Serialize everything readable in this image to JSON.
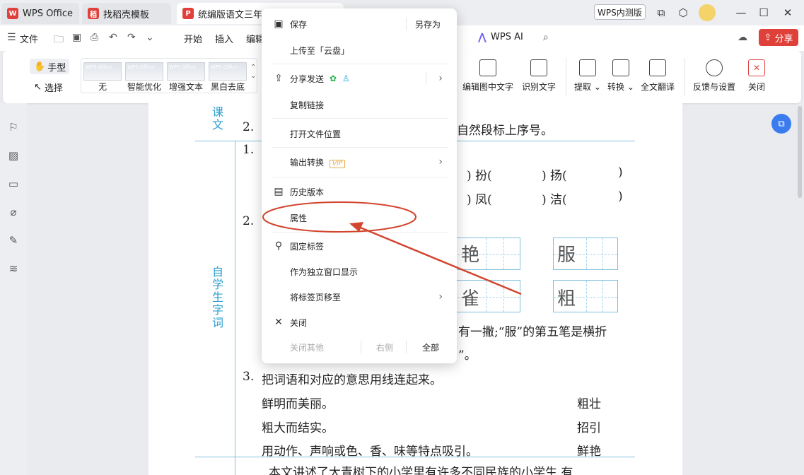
{
  "tabs": [
    {
      "label": "WPS Office",
      "color": "#e0403a"
    },
    {
      "label": "找稻壳模板",
      "color": "#e0403a"
    },
    {
      "label": "统编版语文三年级",
      "color": "#e0403a"
    }
  ],
  "titlebar": {
    "badge": "WPS内测版"
  },
  "menubar": {
    "file": "文件",
    "items": [
      "开始",
      "插入",
      "编辑"
    ],
    "wps_ai": "WPS AI",
    "share": "分享"
  },
  "ribbon": {
    "hand": "手型",
    "select": "选择",
    "thumb_brand": "WPS Office",
    "filters": [
      "无",
      "智能优化",
      "增强文本",
      "黑白去底"
    ],
    "tools": [
      "编辑图中文字",
      "识别文字",
      "提取",
      "转换",
      "全文翻译",
      "反馈与设置",
      "关闭"
    ]
  },
  "context_menu": {
    "save": "保存",
    "save_as": "另存为",
    "upload": "上传至「云盘」",
    "share_send": "分享发送",
    "copy_link": "复制链接",
    "open_location": "打开文件位置",
    "export_convert": "输出转换",
    "vip": "VIP",
    "history": "历史版本",
    "properties": "属性",
    "pin_tab": "固定标签",
    "standalone": "作为独立窗口显示",
    "move_tab": "将标签页移至",
    "close": "关闭",
    "close_others": "关闭其他",
    "right_side": "右侧",
    "all": "全部"
  },
  "document": {
    "label_kewen": "课文",
    "label_zixue": "自学生字词",
    "q2_top": "2.",
    "q2_top_text": "自然段标上序号。",
    "q1": "1.",
    "row1": [
      ") 扮(",
      ") 扬(",
      ")"
    ],
    "row2": [
      ") 凤(",
      ") 洁(",
      ")"
    ],
    "q2_mid": "2.",
    "grid_chars": [
      "艳",
      "服",
      "雀",
      "粗"
    ],
    "note_line1": "有一撇;“服”的第五笔是横折",
    "note_line2": "”。",
    "q3": "3.",
    "q3_text": "把词语和对应的意思用线连起来。",
    "match_left": [
      "鲜明而美丽。",
      "粗大而结实。",
      "用动作、声响或色、香、味等特点吸引。"
    ],
    "match_right": [
      "粗壮",
      "招引",
      "鲜艳"
    ],
    "bottom_text": "本文讲述了大青树下的小学里有许多不同民族的小学生,有"
  }
}
